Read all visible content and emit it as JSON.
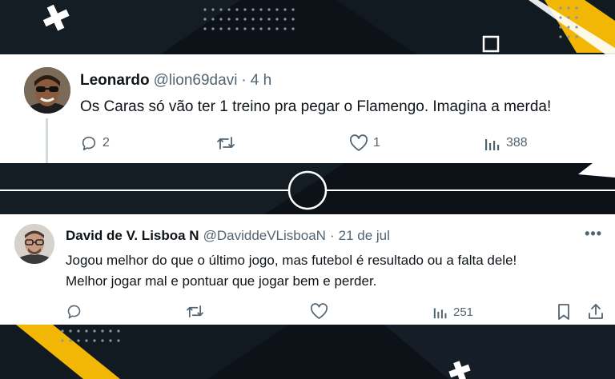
{
  "tweets": [
    {
      "name": "Leonardo",
      "handle": "@lion69davi",
      "separator": "·",
      "time": "4 h",
      "text_lines": [
        "Os Caras só vão ter 1 treino pra pegar o Flamengo. Imagina a merda!"
      ],
      "actions": {
        "reply_count": "2",
        "retweet_count": "",
        "like_count": "1",
        "views_count": "388"
      },
      "icons": [
        "reply-icon",
        "retweet-icon",
        "like-icon",
        "views-icon"
      ]
    },
    {
      "name": "David de V. Lisboa N",
      "handle": "@DaviddeVLisboaN",
      "separator": "·",
      "time": "21 de jul",
      "more": "•••",
      "text_lines": [
        "Jogou melhor do que o último jogo, mas futebol é resultado ou a falta dele!",
        "Melhor jogar mal e pontuar que jogar bem e perder."
      ],
      "actions": {
        "reply_count": "",
        "retweet_count": "",
        "like_count": "",
        "views_count": "251"
      },
      "icons": [
        "reply-icon",
        "retweet-icon",
        "like-icon",
        "views-icon",
        "bookmark-icon",
        "share-icon"
      ]
    }
  ],
  "colors": {
    "background": "#0c1218",
    "accent": "#f2b705",
    "text": "#0f1419",
    "secondary_text": "#536471"
  }
}
